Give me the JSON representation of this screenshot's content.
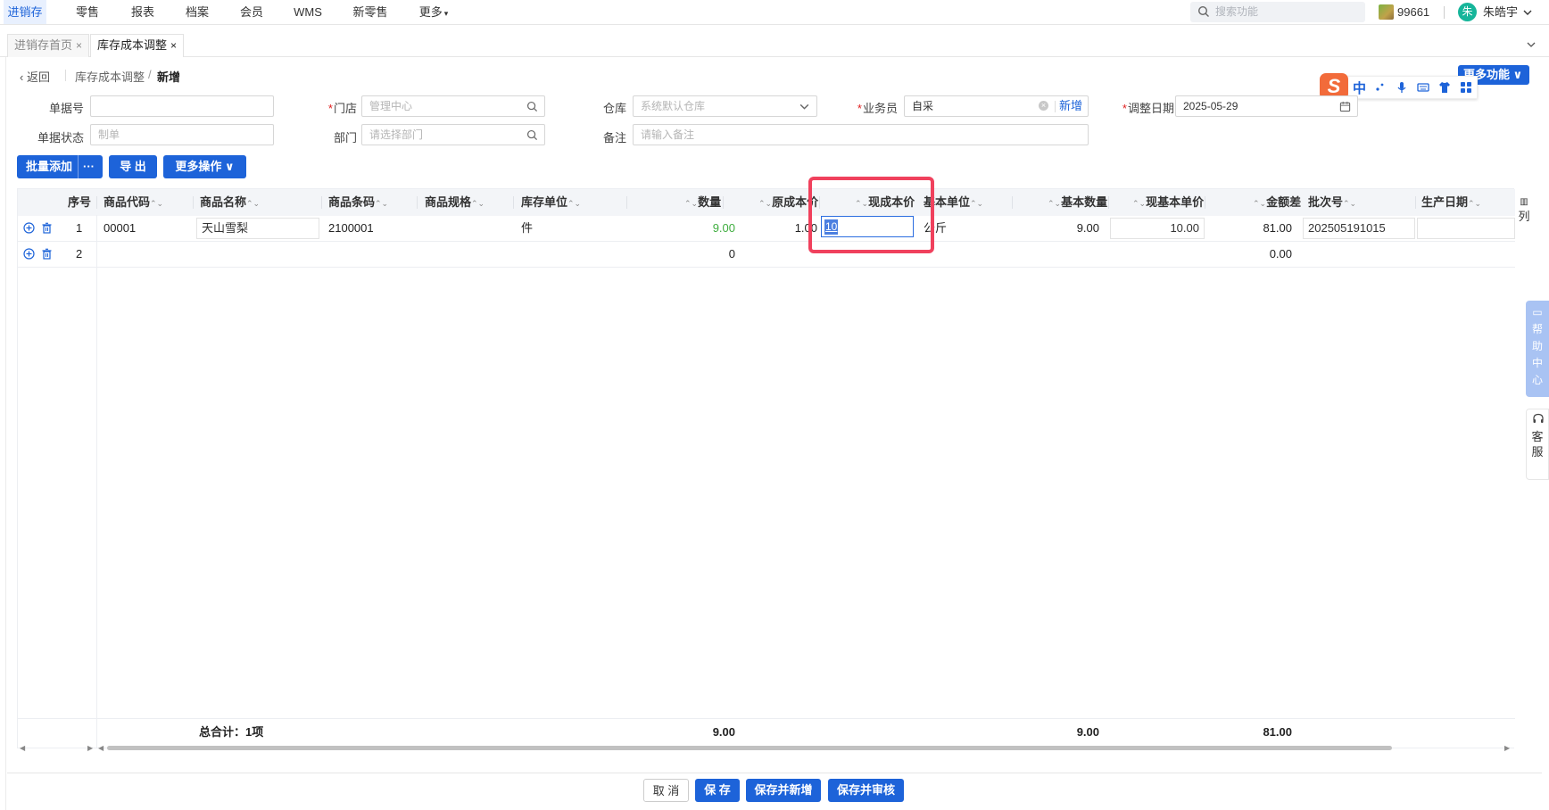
{
  "nav": {
    "items": [
      "进销存",
      "零售",
      "报表",
      "档案",
      "会员",
      "WMS",
      "新零售",
      "更多"
    ],
    "search_placeholder": "搜索功能",
    "coins": "99661",
    "avatar_letter": "朱",
    "user": "朱皓宇"
  },
  "tabs": [
    {
      "label": "进销存首页",
      "close": "×"
    },
    {
      "label": "库存成本调整",
      "close": "×"
    }
  ],
  "breadcrumb": {
    "back": "返回",
    "parent": "库存成本调整",
    "slash": "/",
    "current": "新增"
  },
  "more_functions": "更多功能",
  "ime": {
    "logo": "S",
    "lang": "中"
  },
  "form": {
    "doc_no_label": "单据号",
    "doc_no_value": "",
    "store_label": "门店",
    "store_placeholder": "管理中心",
    "warehouse_label": "仓库",
    "warehouse_placeholder": "系统默认仓库",
    "staff_label": "业务员",
    "staff_value": "自采",
    "staff_new": "新增",
    "staff_clear": "×",
    "date_label": "调整日期",
    "date_value": "2025-05-29",
    "status_label": "单据状态",
    "status_placeholder": "制单",
    "dept_label": "部门",
    "dept_placeholder": "请选择部门",
    "remark_label": "备注",
    "remark_placeholder": "请输入备注",
    "required_mark": "*"
  },
  "toolbar": {
    "batch_add": "批量添加",
    "batch_more": "···",
    "export": "导 出",
    "more_ops": "更多操作"
  },
  "table": {
    "sort_glyph": "⌃⌄",
    "headers": {
      "seq": "序号",
      "code": "商品代码",
      "name": "商品名称",
      "barcode": "商品条码",
      "spec": "商品规格",
      "unit": "库存单位",
      "qty": "数量",
      "orig_cost": "原成本价",
      "new_cost": "现成本价",
      "base_unit": "基本单位",
      "base_qty": "基本数量",
      "new_base_price": "现基本单价",
      "diff": "金额差",
      "batch": "批次号",
      "mfg_date": "生产日期"
    },
    "rows": [
      {
        "seq": "1",
        "code": "00001",
        "name": "天山雪梨",
        "barcode": "2100001",
        "unit": "件",
        "qty": "9.00",
        "orig_cost": "1.00",
        "new_cost": "10",
        "base_unit": "公斤",
        "base_qty": "9.00",
        "new_base_price": "10.00",
        "diff": "81.00",
        "batch": "202505191015"
      },
      {
        "seq": "2",
        "qty": "0",
        "diff": "0.00"
      }
    ],
    "footer": {
      "total_label": "总合计：1项",
      "qty": "9.00",
      "base_qty": "9.00",
      "diff": "81.00"
    },
    "column_toggle": "列"
  },
  "side": {
    "help": [
      "帮",
      "助",
      "中",
      "心"
    ],
    "service": [
      "客",
      "服"
    ]
  },
  "actions": {
    "cancel": "取 消",
    "save": "保 存",
    "save_new": "保存并新增",
    "save_audit": "保存并审核"
  },
  "colors": {
    "primary": "#1d63d9",
    "highlight": "#f0415d",
    "qty_green": "#3fae3f"
  }
}
